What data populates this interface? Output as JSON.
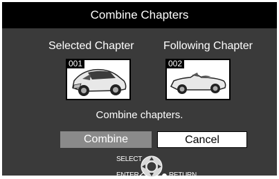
{
  "dialog": {
    "title": "Combine Chapters",
    "selected_label": "Selected Chapter",
    "following_label": "Following Chapter",
    "selected_number": "001",
    "following_number": "002",
    "message": "Combine chapters.",
    "combine_label": "Combine",
    "cancel_label": "Cancel"
  },
  "remote": {
    "select_label": "SELECT",
    "enter_label": "ENTER",
    "return_label": "RETURN"
  },
  "colors": {
    "dialog_bg": "#3a3a3a",
    "titlebar_bg": "#000000",
    "combine_highlight": "#8a8a8a",
    "cancel_bg": "#ffffff"
  },
  "icons": [
    "car-hatchback-thumbnail",
    "car-convertible-thumbnail",
    "directional-pad-icon",
    "return-dot-icon"
  ]
}
